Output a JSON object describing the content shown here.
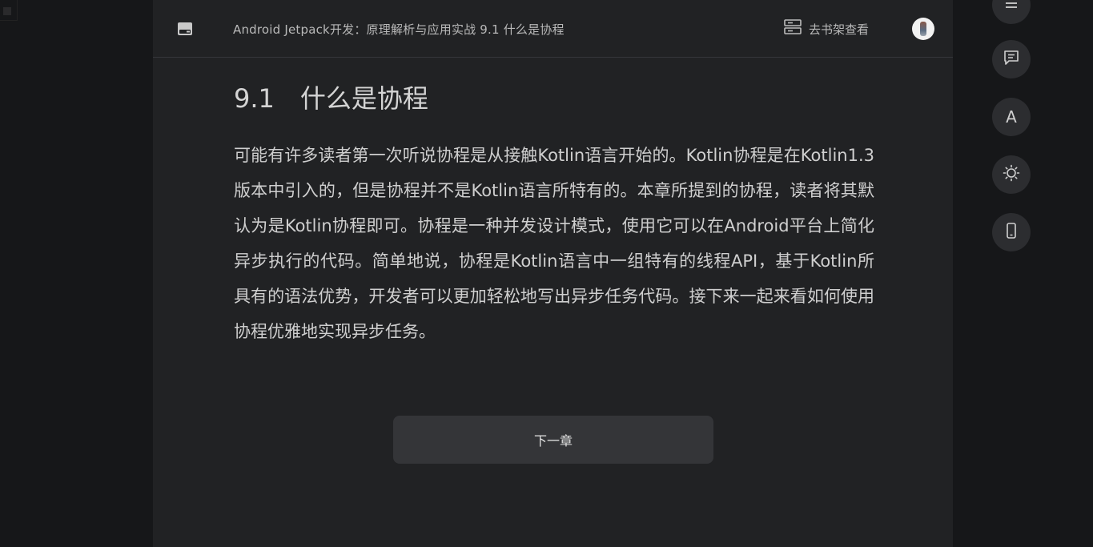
{
  "header": {
    "book_title": "Android Jetpack开发：原理解析与应用实战 9.1 什么是协程",
    "shelf_label": "去书架查看"
  },
  "chapter": {
    "title": "9.1　什么是协程",
    "paragraph": "可能有许多读者第一次听说协程是从接触Kotlin语言开始的。Kotlin协程是在Kotlin1.3版本中引入的，但是协程并不是Kotlin语言所特有的。本章所提到的协程，读者将其默认为是Kotlin协程即可。协程是一种并发设计模式，使用它可以在Android平台上简化异步执行的代码。简单地说，协程是Kotlin语言中一组特有的线程API，基于Kotlin所具有的语法优势，开发者可以更加轻松地写出异步任务代码。接下来一起来看如何使用协程优雅地实现异步任务。"
  },
  "footer": {
    "next_label": "下一章"
  },
  "side_toolbar": {
    "font_label": "A"
  },
  "colors": {
    "page_bg": "#161719",
    "reader_bg": "#212224",
    "button_bg": "#343538",
    "side_button_bg": "#2c2d30",
    "text": "#cfcfcf"
  }
}
